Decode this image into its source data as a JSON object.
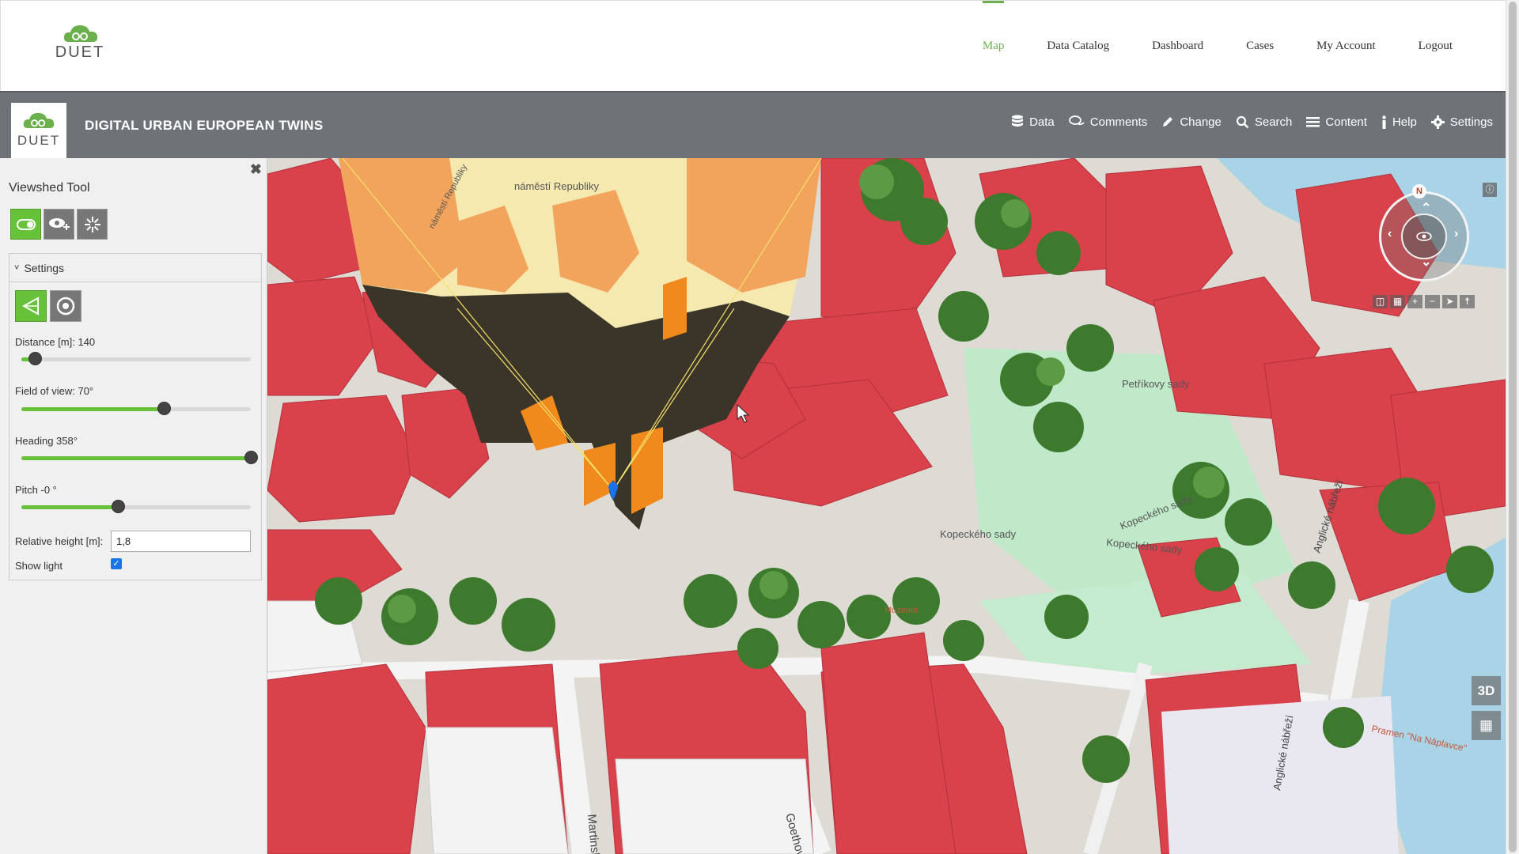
{
  "site": {
    "logo_text": "DUET",
    "nav": [
      {
        "label": "Map",
        "active": true
      },
      {
        "label": "Data Catalog",
        "active": false
      },
      {
        "label": "Dashboard",
        "active": false
      },
      {
        "label": "Cases",
        "active": false
      },
      {
        "label": "My Account",
        "active": false
      },
      {
        "label": "Logout",
        "active": false
      }
    ]
  },
  "app": {
    "logo_text": "DUET",
    "title": "DIGITAL URBAN EUROPEAN TWINS",
    "tools": [
      {
        "label": "Data",
        "icon": "database-icon"
      },
      {
        "label": "Comments",
        "icon": "comments-icon"
      },
      {
        "label": "Change",
        "icon": "pencil-icon"
      },
      {
        "label": "Search",
        "icon": "search-icon"
      },
      {
        "label": "Content",
        "icon": "list-icon"
      },
      {
        "label": "Help",
        "icon": "info-icon"
      },
      {
        "label": "Settings",
        "icon": "gear-icon"
      }
    ]
  },
  "panel": {
    "title": "Viewshed Tool",
    "settings_label": "Settings",
    "distance_label": "Distance [m]: 140",
    "fov_label": "Field of view: 70°",
    "heading_label": "Heading 358°",
    "pitch_label": "Pitch -0 °",
    "relative_height_label": "Relative height [m]:",
    "relative_height_value": "1,8",
    "show_light_label": "Show light",
    "sliders": {
      "distance_fraction": 0.06,
      "fov_fraction": 0.62,
      "heading_fraction": 1.0,
      "pitch_fraction": 0.42
    }
  },
  "map": {
    "labels": {
      "square": "náměstí Republiky",
      "street_namesti": "náměstí Republiky",
      "park": "Petříkovy sady",
      "street_kopeckeho1": "Kopeckého sady",
      "street_kopeckeho2": "Kopeckého sady",
      "street_kopeckeho3": "Kopeckého sady",
      "street_goethova": "Goethova",
      "street_martinska": "Martinská",
      "street_anglicke1": "Anglické nábřeží",
      "street_anglicke2": "Anglické nábřeží",
      "spring": "Pramen \"Na Náplavce\"",
      "museum": "Muzeum"
    },
    "controls": {
      "compass_n": "N",
      "btn_3d": "3D"
    }
  },
  "colors": {
    "accent": "#67c23a",
    "appbar": "#6e7378",
    "roof_red": "#d9414b",
    "viewshed_fill": "#f5e9b0",
    "shadow": "#3a3528"
  }
}
